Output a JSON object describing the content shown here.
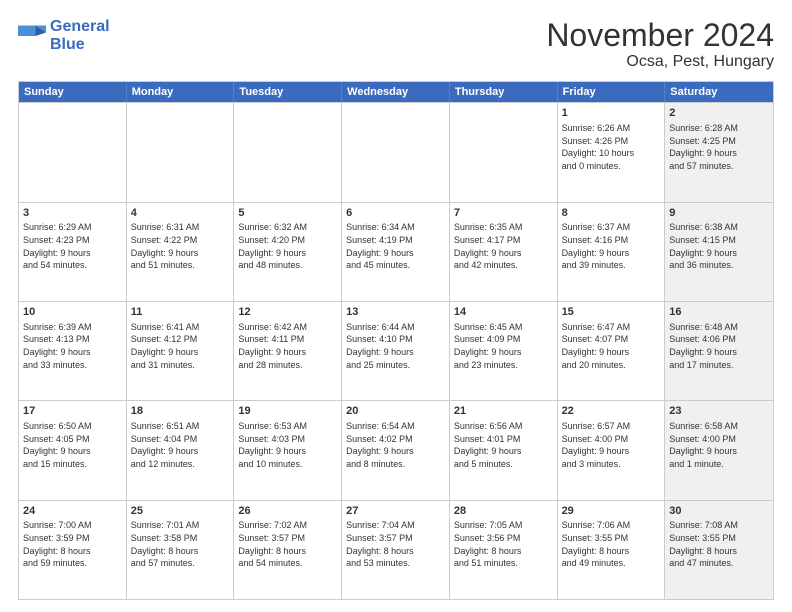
{
  "logo": {
    "line1": "General",
    "line2": "Blue"
  },
  "title": "November 2024",
  "subtitle": "Ocsa, Pest, Hungary",
  "header_days": [
    "Sunday",
    "Monday",
    "Tuesday",
    "Wednesday",
    "Thursday",
    "Friday",
    "Saturday"
  ],
  "weeks": [
    [
      {
        "day": "",
        "info": "",
        "shaded": false
      },
      {
        "day": "",
        "info": "",
        "shaded": false
      },
      {
        "day": "",
        "info": "",
        "shaded": false
      },
      {
        "day": "",
        "info": "",
        "shaded": false
      },
      {
        "day": "",
        "info": "",
        "shaded": false
      },
      {
        "day": "1",
        "info": "Sunrise: 6:26 AM\nSunset: 4:26 PM\nDaylight: 10 hours\nand 0 minutes.",
        "shaded": false
      },
      {
        "day": "2",
        "info": "Sunrise: 6:28 AM\nSunset: 4:25 PM\nDaylight: 9 hours\nand 57 minutes.",
        "shaded": true
      }
    ],
    [
      {
        "day": "3",
        "info": "Sunrise: 6:29 AM\nSunset: 4:23 PM\nDaylight: 9 hours\nand 54 minutes.",
        "shaded": false
      },
      {
        "day": "4",
        "info": "Sunrise: 6:31 AM\nSunset: 4:22 PM\nDaylight: 9 hours\nand 51 minutes.",
        "shaded": false
      },
      {
        "day": "5",
        "info": "Sunrise: 6:32 AM\nSunset: 4:20 PM\nDaylight: 9 hours\nand 48 minutes.",
        "shaded": false
      },
      {
        "day": "6",
        "info": "Sunrise: 6:34 AM\nSunset: 4:19 PM\nDaylight: 9 hours\nand 45 minutes.",
        "shaded": false
      },
      {
        "day": "7",
        "info": "Sunrise: 6:35 AM\nSunset: 4:17 PM\nDaylight: 9 hours\nand 42 minutes.",
        "shaded": false
      },
      {
        "day": "8",
        "info": "Sunrise: 6:37 AM\nSunset: 4:16 PM\nDaylight: 9 hours\nand 39 minutes.",
        "shaded": false
      },
      {
        "day": "9",
        "info": "Sunrise: 6:38 AM\nSunset: 4:15 PM\nDaylight: 9 hours\nand 36 minutes.",
        "shaded": true
      }
    ],
    [
      {
        "day": "10",
        "info": "Sunrise: 6:39 AM\nSunset: 4:13 PM\nDaylight: 9 hours\nand 33 minutes.",
        "shaded": false
      },
      {
        "day": "11",
        "info": "Sunrise: 6:41 AM\nSunset: 4:12 PM\nDaylight: 9 hours\nand 31 minutes.",
        "shaded": false
      },
      {
        "day": "12",
        "info": "Sunrise: 6:42 AM\nSunset: 4:11 PM\nDaylight: 9 hours\nand 28 minutes.",
        "shaded": false
      },
      {
        "day": "13",
        "info": "Sunrise: 6:44 AM\nSunset: 4:10 PM\nDaylight: 9 hours\nand 25 minutes.",
        "shaded": false
      },
      {
        "day": "14",
        "info": "Sunrise: 6:45 AM\nSunset: 4:09 PM\nDaylight: 9 hours\nand 23 minutes.",
        "shaded": false
      },
      {
        "day": "15",
        "info": "Sunrise: 6:47 AM\nSunset: 4:07 PM\nDaylight: 9 hours\nand 20 minutes.",
        "shaded": false
      },
      {
        "day": "16",
        "info": "Sunrise: 6:48 AM\nSunset: 4:06 PM\nDaylight: 9 hours\nand 17 minutes.",
        "shaded": true
      }
    ],
    [
      {
        "day": "17",
        "info": "Sunrise: 6:50 AM\nSunset: 4:05 PM\nDaylight: 9 hours\nand 15 minutes.",
        "shaded": false
      },
      {
        "day": "18",
        "info": "Sunrise: 6:51 AM\nSunset: 4:04 PM\nDaylight: 9 hours\nand 12 minutes.",
        "shaded": false
      },
      {
        "day": "19",
        "info": "Sunrise: 6:53 AM\nSunset: 4:03 PM\nDaylight: 9 hours\nand 10 minutes.",
        "shaded": false
      },
      {
        "day": "20",
        "info": "Sunrise: 6:54 AM\nSunset: 4:02 PM\nDaylight: 9 hours\nand 8 minutes.",
        "shaded": false
      },
      {
        "day": "21",
        "info": "Sunrise: 6:56 AM\nSunset: 4:01 PM\nDaylight: 9 hours\nand 5 minutes.",
        "shaded": false
      },
      {
        "day": "22",
        "info": "Sunrise: 6:57 AM\nSunset: 4:00 PM\nDaylight: 9 hours\nand 3 minutes.",
        "shaded": false
      },
      {
        "day": "23",
        "info": "Sunrise: 6:58 AM\nSunset: 4:00 PM\nDaylight: 9 hours\nand 1 minute.",
        "shaded": true
      }
    ],
    [
      {
        "day": "24",
        "info": "Sunrise: 7:00 AM\nSunset: 3:59 PM\nDaylight: 8 hours\nand 59 minutes.",
        "shaded": false
      },
      {
        "day": "25",
        "info": "Sunrise: 7:01 AM\nSunset: 3:58 PM\nDaylight: 8 hours\nand 57 minutes.",
        "shaded": false
      },
      {
        "day": "26",
        "info": "Sunrise: 7:02 AM\nSunset: 3:57 PM\nDaylight: 8 hours\nand 54 minutes.",
        "shaded": false
      },
      {
        "day": "27",
        "info": "Sunrise: 7:04 AM\nSunset: 3:57 PM\nDaylight: 8 hours\nand 53 minutes.",
        "shaded": false
      },
      {
        "day": "28",
        "info": "Sunrise: 7:05 AM\nSunset: 3:56 PM\nDaylight: 8 hours\nand 51 minutes.",
        "shaded": false
      },
      {
        "day": "29",
        "info": "Sunrise: 7:06 AM\nSunset: 3:55 PM\nDaylight: 8 hours\nand 49 minutes.",
        "shaded": false
      },
      {
        "day": "30",
        "info": "Sunrise: 7:08 AM\nSunset: 3:55 PM\nDaylight: 8 hours\nand 47 minutes.",
        "shaded": true
      }
    ]
  ]
}
